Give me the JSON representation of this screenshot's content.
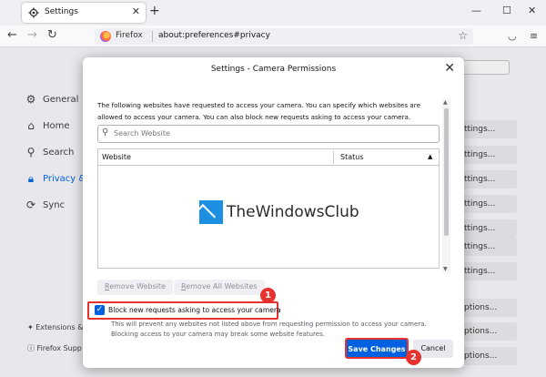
{
  "browser": {
    "tab_title": "Settings",
    "new_tab": "+",
    "tab_close": "✕",
    "controls": {
      "minimize": "—",
      "maximize": "☐",
      "close": "✕"
    },
    "identity_label": "Firefox",
    "url": "about:preferences#privacy"
  },
  "sidebar": {
    "items": [
      {
        "label": "General",
        "icon": "gear-icon"
      },
      {
        "label": "Home",
        "icon": "home-icon"
      },
      {
        "label": "Search",
        "icon": "search-icon"
      },
      {
        "label": "Privacy & S",
        "icon": "lock-icon",
        "selected": true
      },
      {
        "label": "Sync",
        "icon": "sync-icon"
      }
    ],
    "footer": [
      "Extensions &",
      "Firefox Supp"
    ]
  },
  "background_buttons": [
    "ttings...",
    "ttings...",
    "ttings...",
    "ttings...",
    "ttings...",
    "ttings...",
    "ttings...",
    "ptions...",
    "ptions...",
    "ptions..."
  ],
  "dialog": {
    "title": "Settings - Camera Permissions",
    "description": "The following websites have requested to access your camera. You can specify which websites are allowed to access your camera. You can also block new requests asking to access your camera.",
    "search_placeholder": "Search Website",
    "columns": {
      "website": "Website",
      "status": "Status"
    },
    "remove_website": {
      "accesskey": "R",
      "rest": "emove Website"
    },
    "remove_all": {
      "accesskey": "R",
      "rest": "emove All Websites"
    },
    "block_checkbox_label": "Block new requests asking to access your camera",
    "block_checked": true,
    "note": "This will prevent any websites not listed above from requesting permission to access your camera. Blocking access to your camera may break some website features.",
    "save_label": "Save Changes",
    "cancel_label": "Cancel"
  },
  "watermark": "TheWindowsClub",
  "callouts": [
    "1",
    "2"
  ],
  "colors": {
    "accent": "#0060df",
    "callout": "#e8322e"
  }
}
